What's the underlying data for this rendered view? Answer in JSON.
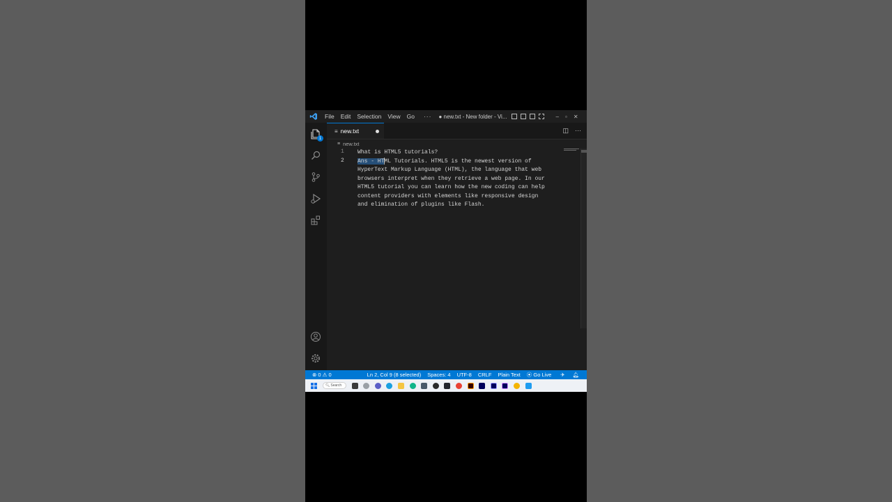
{
  "window": {
    "title": "● new.txt - New folder - Vi...",
    "menu": [
      "File",
      "Edit",
      "Selection",
      "View",
      "Go"
    ],
    "more": "···"
  },
  "tab": {
    "label": "new.txt"
  },
  "breadcrumb": {
    "file": "new.txt"
  },
  "activity": {
    "explorer_badge": "1"
  },
  "editor": {
    "line_numbers": [
      "1",
      "2"
    ],
    "line1": "What is HTML5 tutorials?",
    "line2_selected": "Ans - HT",
    "line2_rest": "ML Tutorials. HTML5 is the newest version of",
    "wrapped": [
      "HyperText Markup Language (HTML), the language that web",
      "browsers interpret when they retrieve a web page. In our",
      "HTML5 tutorial you can learn how the new coding can help",
      "content providers with elements like responsive design",
      "and elimination of plugins like Flash."
    ]
  },
  "status": {
    "errors": "0",
    "warnings": "0",
    "position": "Ln 2, Col 9 (8 selected)",
    "spaces": "Spaces: 4",
    "encoding": "UTF-8",
    "eol": "CRLF",
    "language": "Plain Text",
    "golive": "Go Live"
  },
  "taskbar": {
    "search": "Search",
    "apps": [
      "file-explorer-icon",
      "settings-icon",
      "chat-icon",
      "edge-icon",
      "folder-icon",
      "edge-dev-icon",
      "calculator-icon",
      "steam-icon",
      "terminal-icon",
      "chrome-icon",
      "illustrator-icon",
      "media-encoder-icon",
      "after-effects-icon",
      "premiere-icon",
      "chrome-canary-icon",
      "vscode-icon"
    ]
  },
  "colors": {
    "accent": "#0078d4",
    "selection": "#264f78"
  }
}
